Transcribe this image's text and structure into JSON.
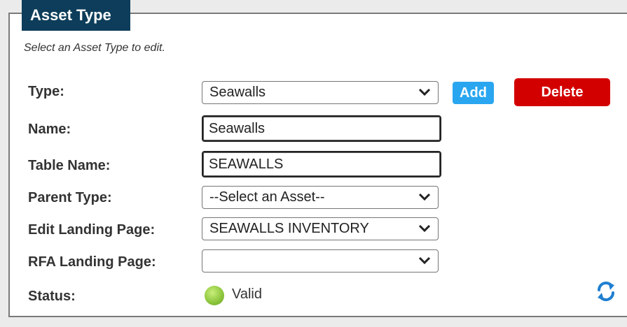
{
  "panel": {
    "title": "Asset Type",
    "hint": "Select an Asset Type to edit."
  },
  "form": {
    "type_label": "Type:",
    "type_value": "Seawalls",
    "add_label": "Add",
    "delete_label": "Delete",
    "name_label": "Name:",
    "name_value": "Seawalls",
    "table_name_label": "Table Name:",
    "table_name_value": "SEAWALLS",
    "parent_type_label": "Parent Type:",
    "parent_type_value": "--Select an Asset--",
    "edit_landing_label": "Edit Landing Page:",
    "edit_landing_value": "SEAWALLS INVENTORY",
    "rfa_landing_label": "RFA Landing Page:",
    "rfa_landing_value": "",
    "status_label": "Status:",
    "status_value": "Valid"
  },
  "icons": {
    "dropdown": "chevron-down-icon",
    "status": "status-valid-icon",
    "refresh": "refresh-icon"
  },
  "colors": {
    "header_bg": "#0d3d5a",
    "add_button": "#2aa6f0",
    "delete_button": "#d30000",
    "status_ok": "#8bc43a",
    "refresh": "#1f7fd1"
  }
}
